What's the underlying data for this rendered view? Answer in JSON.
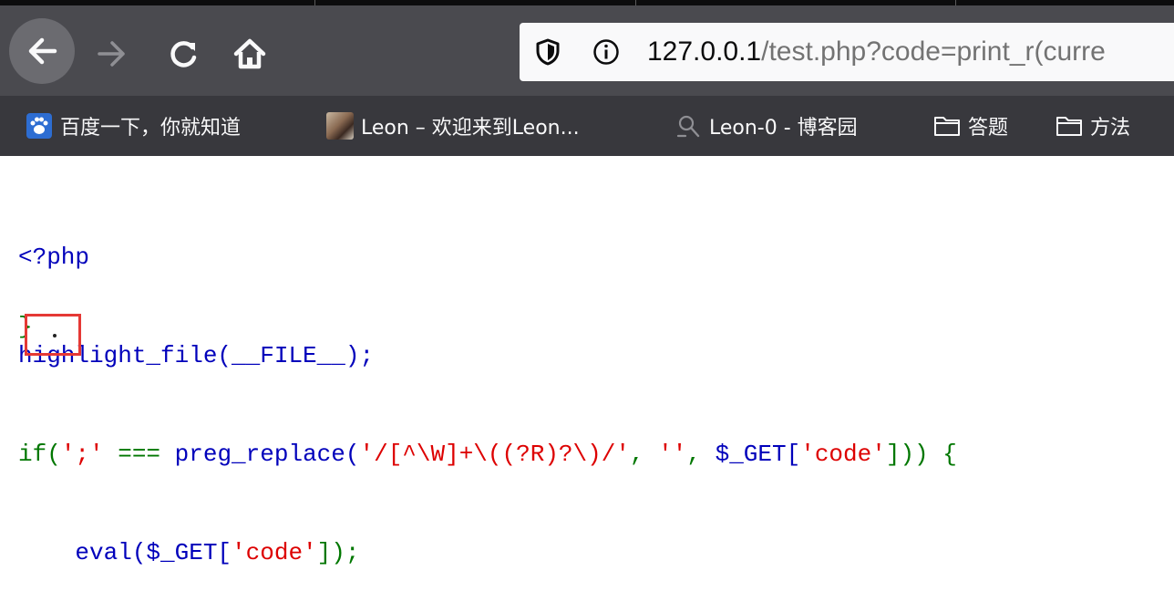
{
  "browser": {
    "url_host": "127.0.0.1",
    "url_rest": "/test.php?code=print_r(curre",
    "nav_icons": [
      "back-arrow-icon",
      "forward-arrow-icon",
      "reload-icon",
      "home-icon"
    ],
    "url_icons": [
      "shield-icon",
      "info-icon"
    ]
  },
  "bookmarks": [
    {
      "label": "百度一下，你就知道",
      "icon": "baidu-paw-icon"
    },
    {
      "label": "Leon – 欢迎来到Leon...",
      "icon": "avatar-icon"
    },
    {
      "label": "Leon-0 - 博客园",
      "icon": "cnblogs-icon"
    },
    {
      "label": "答题",
      "icon": "folder-icon"
    },
    {
      "label": "方法",
      "icon": "folder-icon"
    }
  ],
  "code": {
    "line1": "<?php",
    "line2_fn": "highlight_file(__FILE__);",
    "line3_if": "if(",
    "line3_s1": "';'",
    "line3_op": " === ",
    "line3_fn": "preg_replace(",
    "line3_s2": "'/[^\\W]+\\((?R)?\\)/'",
    "line3_c1": ", ",
    "line3_s3": "''",
    "line3_c2": ", ",
    "line3_var": "$_GET[",
    "line3_s4": "'code'",
    "line3_end": "])) {",
    "line4_fn": "    eval($_GET[",
    "line4_s": "'code'",
    "line4_end": "]);",
    "line5": "}"
  },
  "colors": {
    "php_default": "#0000bb",
    "php_keyword": "#007700",
    "php_string": "#dd0000",
    "highlight_box": "#e53935",
    "toolbar_bg": "#4a4a4f",
    "bookmarks_bg": "#38383d"
  }
}
